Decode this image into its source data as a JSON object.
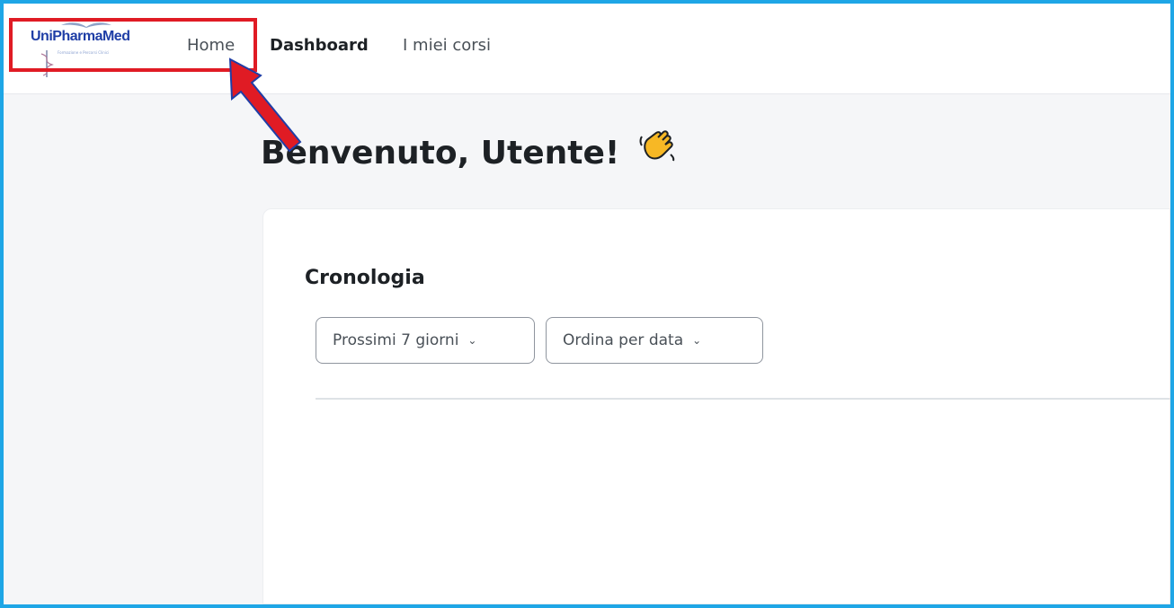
{
  "brand": {
    "name_part1": "Uni",
    "name_part2": "PharmaMed",
    "tagline": "Formazione e Percorsi Clinici"
  },
  "nav": {
    "items": [
      {
        "label": "Home"
      },
      {
        "label": "Dashboard"
      },
      {
        "label": "I miei corsi"
      }
    ]
  },
  "main": {
    "title": "Benvenuto, Utente!",
    "title_emoji": "waving-hand-icon"
  },
  "timeline": {
    "heading": "Cronologia",
    "filter_label": "Prossimi 7 giorni",
    "sort_label": "Ordina per data"
  },
  "annotation": {
    "highlight_color": "#e01b24",
    "arrow_color": "#e01b24",
    "frame_color": "#1ea6e6"
  }
}
